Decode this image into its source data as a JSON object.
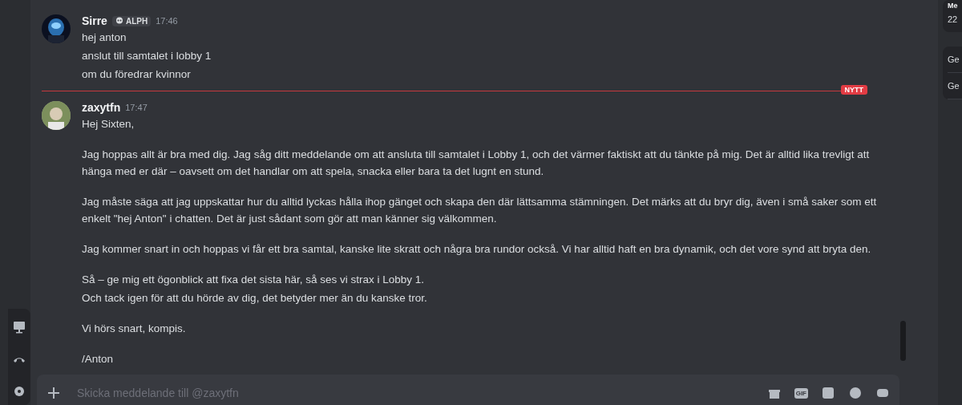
{
  "messages": [
    {
      "author": "Sirre",
      "tag": "ALPH",
      "time": "17:46",
      "paragraphs": [
        [
          "hej anton",
          "anslut till samtalet i lobby 1",
          "om du föredrar kvinnor"
        ]
      ]
    },
    {
      "author": "zaxytfn",
      "time": "17:47",
      "paragraphs": [
        [
          "Hej Sixten,"
        ],
        [
          "Jag hoppas allt är bra med dig. Jag såg ditt meddelande om att ansluta till samtalet i Lobby 1, och det värmer faktiskt att du tänkte på mig. Det är alltid lika trevligt att hänga med er där – oavsett om det handlar om att spela, snacka eller bara ta det lugnt en stund."
        ],
        [
          "Jag måste säga att jag uppskattar hur du alltid lyckas hålla ihop gänget och skapa den där lättsamma stämningen. Det märks att du bryr dig, även i små saker som ett enkelt \"hej Anton\" i chatten. Det är just sådant som gör att man känner sig välkommen."
        ],
        [
          "Jag kommer snart in och hoppas vi får ett bra samtal, kanske lite skratt och några bra rundor också. Vi har alltid haft en bra dynamik, och det vore synd att bryta den."
        ],
        [
          "Så – ge mig ett ögonblick att fixa det sista här, så ses vi strax i Lobby 1.",
          "Och tack igen för att du hörde av dig, det betyder mer än du kanske tror."
        ],
        [
          "Vi hörs snart, kompis."
        ],
        [
          "/Anton"
        ]
      ]
    }
  ],
  "new_divider": {
    "label": "NYTT"
  },
  "composer": {
    "placeholder": "Skicka meddelande till @zaxytfn",
    "gif_label": "GIF"
  },
  "right_panel": {
    "heading": "Me",
    "count": "22",
    "items": [
      "Ge",
      "Ge"
    ]
  }
}
